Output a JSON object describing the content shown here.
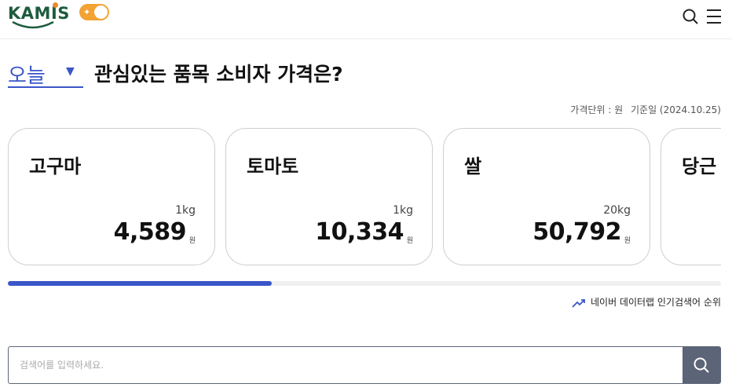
{
  "header": {
    "logo_text": "KAMIS",
    "logo_ka": "KA",
    "logo_m": "M",
    "logo_i": "I",
    "logo_s": "S",
    "toggle_icon": "star-icon",
    "search_icon": "search-icon",
    "menu_icon": "hamburger-menu-icon"
  },
  "title_row": {
    "period_label": "오늘",
    "caret": "▼",
    "title": "관심있는 품목 소비자 가격은?"
  },
  "unit_info": {
    "unit_label": "가격단위 : 원",
    "date_label": "기준일 (2024.10.25)"
  },
  "cards": [
    {
      "name": "고구마",
      "unit": "1kg",
      "price": "4,589",
      "currency": "원"
    },
    {
      "name": "토마토",
      "unit": "1kg",
      "price": "10,334",
      "currency": "원"
    },
    {
      "name": "쌀",
      "unit": "20kg",
      "price": "50,792",
      "currency": "원"
    },
    {
      "name": "당근",
      "unit": "",
      "price": "",
      "currency": ""
    }
  ],
  "progress": {
    "value": 0.37
  },
  "trend": {
    "icon": "trending-up-icon",
    "label": "네이버 데이터랩 인기검색어 순위"
  },
  "search": {
    "placeholder": "검색어를 입력하세요.",
    "value": "",
    "button_icon": "search-icon"
  },
  "colors": {
    "accent": "#3a56c8",
    "logo_green": "#1d5c3d",
    "toggle_orange": "#f3a233",
    "search_button": "#5c6577"
  }
}
